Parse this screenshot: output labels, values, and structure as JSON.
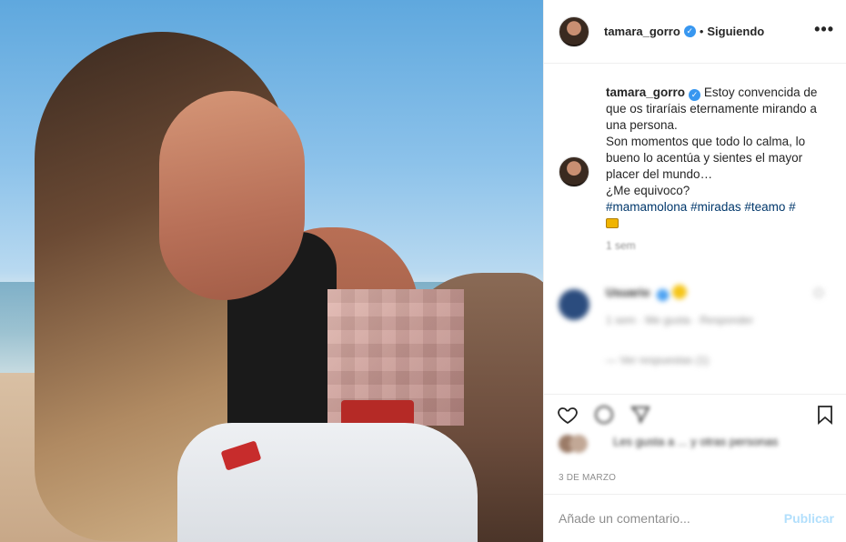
{
  "header": {
    "username": "tamara_gorro",
    "verified": true,
    "separator": "•",
    "follow_status": "Siguiendo",
    "more_icon": "more-horizontal-icon"
  },
  "caption": {
    "username": "tamara_gorro",
    "line1": "Estoy convencida de que os tiraríais eternamente mirando a una persona.",
    "line2": "Son momentos que todo lo calma, lo bueno lo acentúa y sientes el mayor placer del mundo…",
    "line3": "¿Me equivoco?",
    "hashtags": [
      "#mamamolona",
      "#miradas",
      "#teamo",
      "#"
    ],
    "emoji_icon": "crown-emoji-icon",
    "time": "1 sem"
  },
  "blurred_comment": {
    "name": "Usuario",
    "meta": "1 sem  ·  Me gusta  ·  Responder",
    "replies": "—  Ver respuestas (1)"
  },
  "actions": {
    "like_icon": "heart-icon",
    "comment_icon": "comment-icon",
    "share_icon": "share-icon",
    "save_icon": "bookmark-icon"
  },
  "likes": {
    "text": "Les gusta a ... y otras personas"
  },
  "date": "3 DE MARZO",
  "add_comment": {
    "placeholder": "Añade un comentario...",
    "publish_label": "Publicar"
  },
  "colors": {
    "link": "#00376b",
    "verified": "#3897f0",
    "muted": "#8e8e8e",
    "publish_disabled": "#b2dffc"
  }
}
